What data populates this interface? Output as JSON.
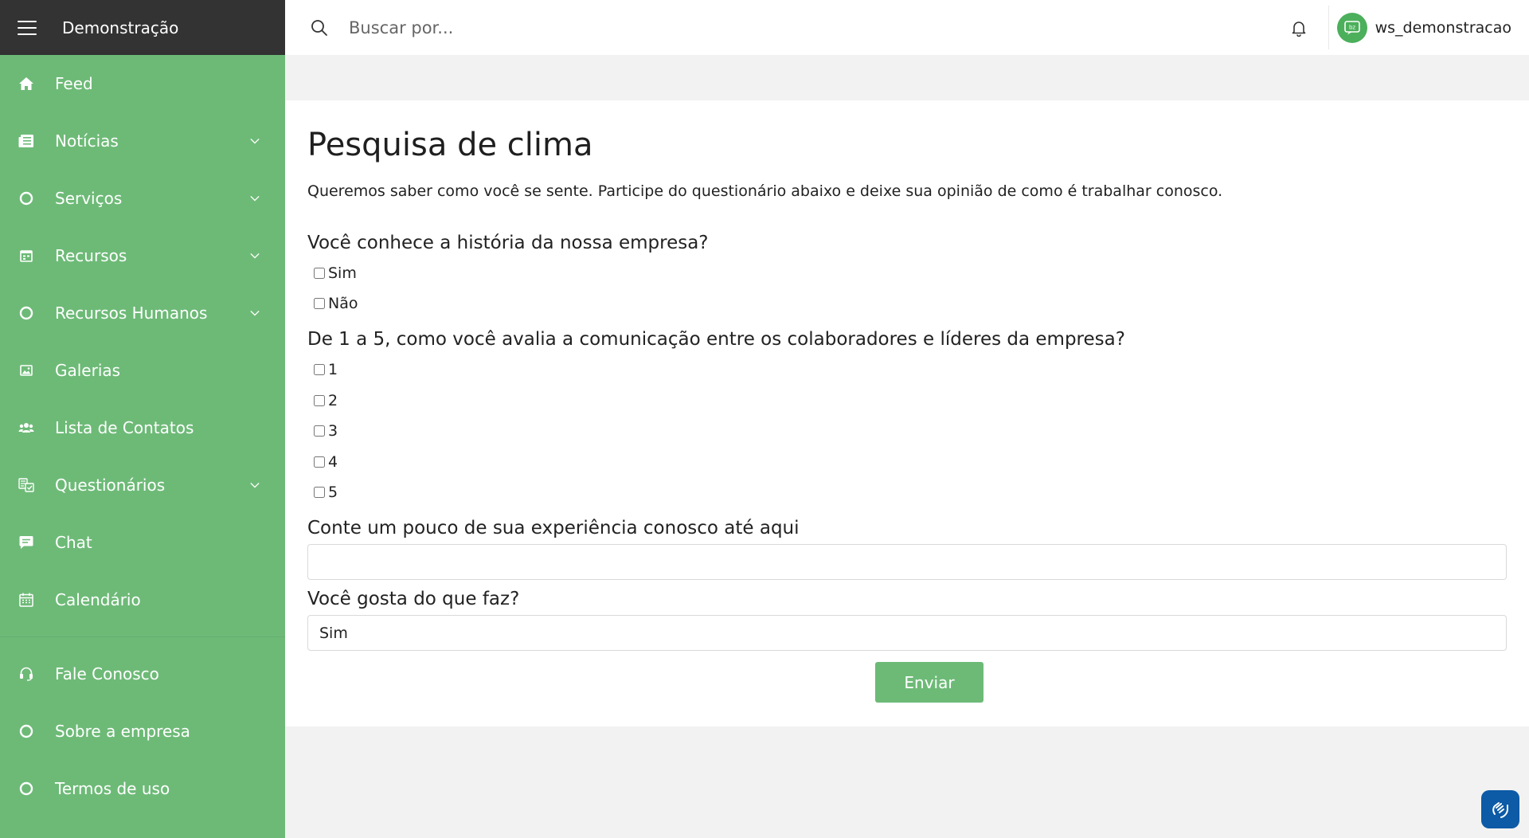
{
  "app": {
    "brand": "Demonstração"
  },
  "sidebar": {
    "items": [
      {
        "label": "Feed"
      },
      {
        "label": "Notícias"
      },
      {
        "label": "Serviços"
      },
      {
        "label": "Recursos"
      },
      {
        "label": "Recursos Humanos"
      },
      {
        "label": "Galerias"
      },
      {
        "label": "Lista de Contatos"
      },
      {
        "label": "Questionários"
      },
      {
        "label": "Chat"
      },
      {
        "label": "Calendário"
      }
    ],
    "bottom_items": [
      {
        "label": "Fale Conosco"
      },
      {
        "label": "Sobre a empresa"
      },
      {
        "label": "Termos de uso"
      }
    ]
  },
  "topbar": {
    "search_placeholder": "Buscar por...",
    "username": "ws_demonstracao",
    "avatar_text": "bz"
  },
  "survey": {
    "title": "Pesquisa de clima",
    "intro": "Queremos saber como você se sente. Participe do questionário abaixo e deixe sua opinião de como é trabalhar conosco.",
    "q1": {
      "label": "Você conhece a história da nossa empresa?",
      "options": [
        "Sim",
        "Não"
      ]
    },
    "q2": {
      "label": "De 1 a 5, como você avalia a comunicação entre os colaboradores e líderes da empresa?",
      "options": [
        "1",
        "2",
        "3",
        "4",
        "5"
      ]
    },
    "q3": {
      "label": "Conte um pouco de sua experiência conosco até aqui",
      "value": ""
    },
    "q4": {
      "label": "Você gosta do que faz?",
      "value": "Sim"
    },
    "submit_label": "Enviar"
  }
}
